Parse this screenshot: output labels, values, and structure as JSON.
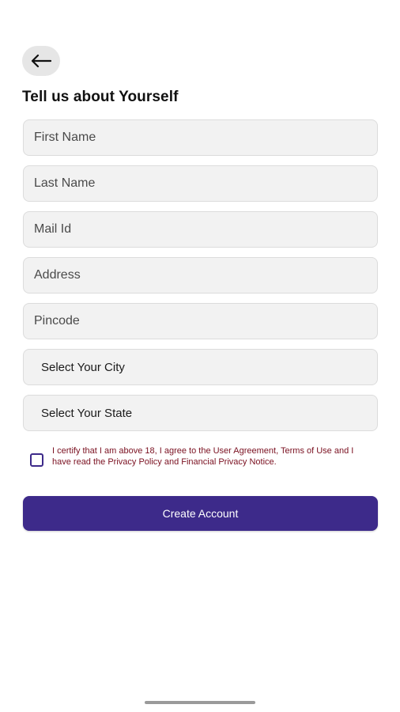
{
  "header": {
    "back_icon": "arrow-left-icon",
    "title": "Tell us about Yourself"
  },
  "form": {
    "first_name": {
      "placeholder": "First Name",
      "value": ""
    },
    "last_name": {
      "placeholder": "Last Name",
      "value": ""
    },
    "mail_id": {
      "placeholder": "Mail Id",
      "value": ""
    },
    "address": {
      "placeholder": "Address",
      "value": ""
    },
    "pincode": {
      "placeholder": "Pincode",
      "value": ""
    },
    "city": {
      "selected": "Select Your City"
    },
    "state": {
      "selected": "Select Your State"
    },
    "consent": {
      "checked": false,
      "text": "I certify that I am above 18, I agree to the User Agreement, Terms of Use and I have read the Privacy Policy and Financial Privacy Notice."
    },
    "submit_label": "Create Account"
  },
  "colors": {
    "accent": "#3d2a8a",
    "field_background": "#f2f2f2",
    "consent_text": "#7a1020"
  }
}
